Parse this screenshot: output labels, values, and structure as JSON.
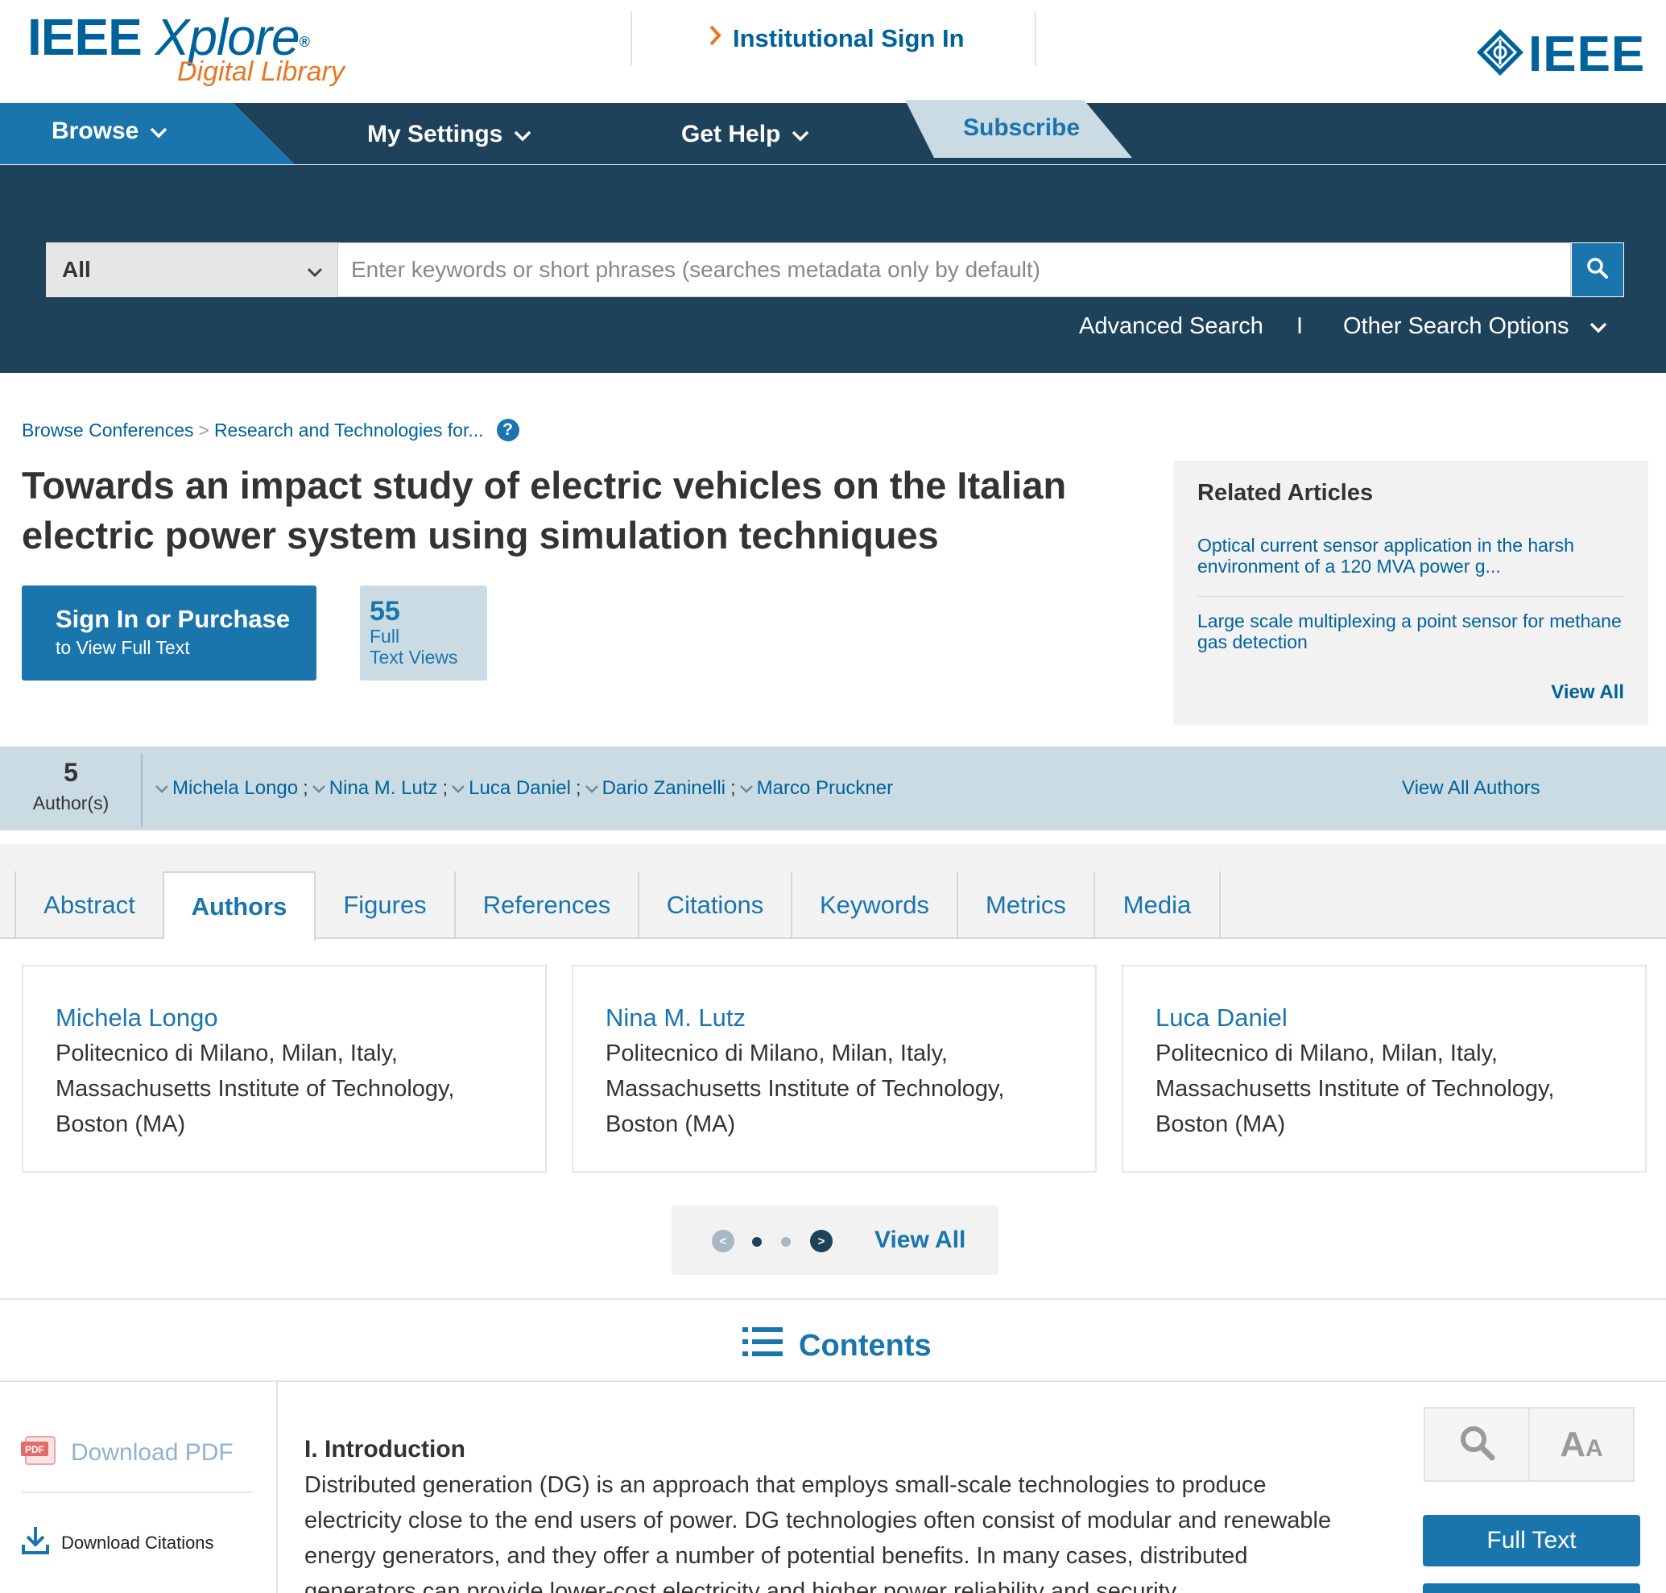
{
  "header": {
    "logo_main": "IEEE ",
    "logo_x": "Xplore",
    "logo_reg": "®",
    "logo_sub": "Digital Library",
    "institutional_signin": "Institutional Sign In",
    "ieee_brand": "IEEE"
  },
  "nav": {
    "browse": "Browse",
    "my_settings": "My Settings",
    "get_help": "Get Help",
    "subscribe": "Subscribe"
  },
  "search": {
    "scope_selected": "All",
    "placeholder": "Enter keywords or short phrases (searches metadata only by default)",
    "advanced": "Advanced Search",
    "divider": "I",
    "other_options": "Other Search Options"
  },
  "breadcrumb": {
    "items": [
      "Browse Conferences",
      "Research and Technologies for..."
    ],
    "separator": ">",
    "help": "?"
  },
  "article": {
    "title": "Towards an impact study of electric vehicles on the Italian electric power system using simulation techniques",
    "signin_line1": "Sign In or Purchase",
    "signin_line2": "to View Full Text",
    "views_count": "55",
    "views_label_1": "Full",
    "views_label_2": "Text Views"
  },
  "related": {
    "heading": "Related Articles",
    "items": [
      "Optical current sensor application in the harsh environment of a 120 MVA power g...",
      "Large scale multiplexing a point sensor for methane gas detection"
    ],
    "view_all": "View All"
  },
  "authors_bar": {
    "count": "5",
    "label": "Author(s)",
    "names": [
      "Michela Longo",
      "Nina M. Lutz",
      "Luca Daniel",
      "Dario Zaninelli",
      "Marco Pruckner"
    ],
    "separator": ";",
    "view_all": "View All Authors"
  },
  "tabs": [
    "Abstract",
    "Authors",
    "Figures",
    "References",
    "Citations",
    "Keywords",
    "Metrics",
    "Media"
  ],
  "active_tab": "Authors",
  "author_cards": [
    {
      "name": "Michela Longo",
      "affiliation": "Politecnico di Milano, Milan, Italy, Massachusetts Institute of Technology, Boston (MA)"
    },
    {
      "name": "Nina M. Lutz",
      "affiliation": "Politecnico di Milano, Milan, Italy, Massachusetts Institute of Technology, Boston (MA)"
    },
    {
      "name": "Luca Daniel",
      "affiliation": "Politecnico di Milano, Milan, Italy, Massachusetts Institute of Technology, Boston (MA)"
    }
  ],
  "pager": {
    "prev": "<",
    "next": ">",
    "view_all": "View All",
    "pages": 2,
    "current": 1
  },
  "contents": {
    "heading": "Contents"
  },
  "sidebar": {
    "download_pdf": "Download PDF",
    "pdf_icon_text": "PDF",
    "download_citations": "Download Citations"
  },
  "body": {
    "section_heading": "I. Introduction",
    "paragraph": "Distributed generation (DG) is an approach that employs small-scale technologies to produce electricity close to the end users of power. DG technologies often consist of modular and renewable energy generators, and they offer a number of potential benefits. In many cases, distributed generators can provide lower-cost electricity and higher power reliability and security"
  },
  "tools": {
    "text_size_large": "A",
    "text_size_small": "A",
    "full_text": "Full Text"
  },
  "colors": {
    "primary": "#1a75ad",
    "brand_blue": "#00629b",
    "nav_dark": "#1e4259",
    "accent_orange": "#e87722",
    "light_blue_panel": "#cbdbe4"
  },
  "icons": [
    "chevron-right-icon",
    "ieee-diamond-icon",
    "chevron-down-icon",
    "search-icon",
    "help-icon",
    "list-icon",
    "pdf-icon",
    "download-icon",
    "magnify-icon",
    "text-size-icon"
  ]
}
